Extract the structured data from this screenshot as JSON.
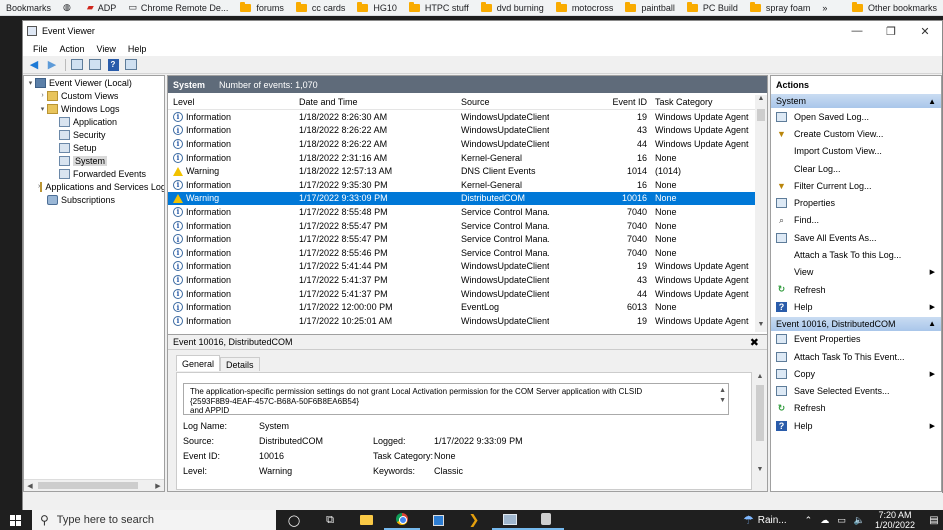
{
  "bookmarks": [
    {
      "label": "Bookmarks",
      "icon": "none"
    },
    {
      "label": "",
      "icon": "globe-icon"
    },
    {
      "label": "ADP",
      "icon": "adp-icon"
    },
    {
      "label": "Chrome Remote De...",
      "icon": "remote-icon"
    },
    {
      "label": "forums",
      "icon": "folder-icon"
    },
    {
      "label": "cc cards",
      "icon": "folder-icon"
    },
    {
      "label": "HG10",
      "icon": "folder-icon"
    },
    {
      "label": "HTPC stuff",
      "icon": "folder-icon"
    },
    {
      "label": "dvd burning",
      "icon": "folder-icon"
    },
    {
      "label": "motocross",
      "icon": "folder-icon"
    },
    {
      "label": "paintball",
      "icon": "folder-icon"
    },
    {
      "label": "PC Build",
      "icon": "folder-icon"
    },
    {
      "label": "spray foam",
      "icon": "folder-icon"
    },
    {
      "label": "»",
      "icon": "none"
    },
    {
      "label": "Other bookmarks",
      "icon": "folder-icon"
    }
  ],
  "window": {
    "title": "Event Viewer",
    "controls": {
      "minimize": "—",
      "restore": "❐",
      "close": "✕"
    }
  },
  "menu": [
    "File",
    "Action",
    "View",
    "Help"
  ],
  "tree": [
    {
      "label": "Event Viewer (Local)",
      "level": 0,
      "expander": "▾",
      "icon": "event-viewer-icon"
    },
    {
      "label": "Custom Views",
      "level": 1,
      "expander": "›",
      "icon": "folder-icon"
    },
    {
      "label": "Windows Logs",
      "level": 1,
      "expander": "▾",
      "icon": "folder-icon"
    },
    {
      "label": "Application",
      "level": 2,
      "expander": "",
      "icon": "log-icon"
    },
    {
      "label": "Security",
      "level": 2,
      "expander": "",
      "icon": "log-icon"
    },
    {
      "label": "Setup",
      "level": 2,
      "expander": "",
      "icon": "log-icon"
    },
    {
      "label": "System",
      "level": 2,
      "expander": "",
      "icon": "log-icon",
      "selected": true
    },
    {
      "label": "Forwarded Events",
      "level": 2,
      "expander": "",
      "icon": "log-icon"
    },
    {
      "label": "Applications and Services Log",
      "level": 1,
      "expander": "›",
      "icon": "folder-icon"
    },
    {
      "label": "Subscriptions",
      "level": 1,
      "expander": "",
      "icon": "subscriptions-icon"
    }
  ],
  "center": {
    "log_name": "System",
    "event_count": "Number of events: 1,070",
    "columns": {
      "level": "Level",
      "date": "Date and Time",
      "source": "Source",
      "id": "Event ID",
      "category": "Task Category"
    },
    "rows": [
      {
        "level": "Information",
        "date": "1/18/2022 8:26:30 AM",
        "source": "WindowsUpdateClient",
        "id": "19",
        "category": "Windows Update Agent"
      },
      {
        "level": "Information",
        "date": "1/18/2022 8:26:22 AM",
        "source": "WindowsUpdateClient",
        "id": "43",
        "category": "Windows Update Agent"
      },
      {
        "level": "Information",
        "date": "1/18/2022 8:26:22 AM",
        "source": "WindowsUpdateClient",
        "id": "44",
        "category": "Windows Update Agent"
      },
      {
        "level": "Information",
        "date": "1/18/2022 2:31:16 AM",
        "source": "Kernel-General",
        "id": "16",
        "category": "None"
      },
      {
        "level": "Warning",
        "date": "1/18/2022 12:57:13 AM",
        "source": "DNS Client Events",
        "id": "1014",
        "category": "(1014)"
      },
      {
        "level": "Information",
        "date": "1/17/2022 9:35:30 PM",
        "source": "Kernel-General",
        "id": "16",
        "category": "None"
      },
      {
        "level": "Warning",
        "date": "1/17/2022 9:33:09 PM",
        "source": "DistributedCOM",
        "id": "10016",
        "category": "None",
        "selected": true
      },
      {
        "level": "Information",
        "date": "1/17/2022 8:55:48 PM",
        "source": "Service Control Mana...",
        "id": "7040",
        "category": "None"
      },
      {
        "level": "Information",
        "date": "1/17/2022 8:55:47 PM",
        "source": "Service Control Mana...",
        "id": "7040",
        "category": "None"
      },
      {
        "level": "Information",
        "date": "1/17/2022 8:55:47 PM",
        "source": "Service Control Mana...",
        "id": "7040",
        "category": "None"
      },
      {
        "level": "Information",
        "date": "1/17/2022 8:55:46 PM",
        "source": "Service Control Mana...",
        "id": "7040",
        "category": "None"
      },
      {
        "level": "Information",
        "date": "1/17/2022 5:41:44 PM",
        "source": "WindowsUpdateClient",
        "id": "19",
        "category": "Windows Update Agent"
      },
      {
        "level": "Information",
        "date": "1/17/2022 5:41:37 PM",
        "source": "WindowsUpdateClient",
        "id": "43",
        "category": "Windows Update Agent"
      },
      {
        "level": "Information",
        "date": "1/17/2022 5:41:37 PM",
        "source": "WindowsUpdateClient",
        "id": "44",
        "category": "Windows Update Agent"
      },
      {
        "level": "Information",
        "date": "1/17/2022 12:00:00 PM",
        "source": "EventLog",
        "id": "6013",
        "category": "None"
      },
      {
        "level": "Information",
        "date": "1/17/2022 10:25:01 AM",
        "source": "WindowsUpdateClient",
        "id": "19",
        "category": "Windows Update Agent"
      }
    ]
  },
  "detail": {
    "header": "Event 10016, DistributedCOM",
    "close": "✖",
    "tabs": [
      "General",
      "Details"
    ],
    "description_lines": [
      "The application-specific permission settings do not grant Local Activation permission for the COM Server application with CLSID",
      "{2593F8B9-4EAF-457C-B68A-50F6B8EA6B54}",
      " and APPID"
    ],
    "fields": {
      "log_name_label": "Log Name:",
      "log_name": "System",
      "source_label": "Source:",
      "source": "DistributedCOM",
      "logged_label": "Logged:",
      "logged": "1/17/2022 9:33:09 PM",
      "event_id_label": "Event ID:",
      "event_id": "10016",
      "task_category_label": "Task Category:",
      "task_category": "None",
      "level_label": "Level:",
      "level": "Warning",
      "keywords_label": "Keywords:",
      "keywords": "Classic"
    }
  },
  "actions": {
    "title": "Actions",
    "sections": [
      {
        "title": "System",
        "items": [
          {
            "label": "Open Saved Log...",
            "icon": "open-log-icon",
            "submenu": false
          },
          {
            "label": "Create Custom View...",
            "icon": "filter-icon",
            "submenu": false
          },
          {
            "label": "Import Custom View...",
            "icon": "none",
            "submenu": false
          },
          {
            "label": "Clear Log...",
            "icon": "none",
            "submenu": false
          },
          {
            "label": "Filter Current Log...",
            "icon": "filter-icon",
            "submenu": false
          },
          {
            "label": "Properties",
            "icon": "properties-icon",
            "submenu": false
          },
          {
            "label": "Find...",
            "icon": "find-icon",
            "submenu": false
          },
          {
            "label": "Save All Events As...",
            "icon": "save-icon",
            "submenu": false
          },
          {
            "label": "Attach a Task To this Log...",
            "icon": "none",
            "submenu": false
          },
          {
            "label": "View",
            "icon": "none",
            "submenu": true
          },
          {
            "label": "Refresh",
            "icon": "refresh-icon",
            "submenu": false
          },
          {
            "label": "Help",
            "icon": "help-icon",
            "submenu": true
          }
        ]
      },
      {
        "title": "Event 10016, DistributedCOM",
        "items": [
          {
            "label": "Event Properties",
            "icon": "properties-icon",
            "submenu": false
          },
          {
            "label": "Attach Task To This Event...",
            "icon": "task-icon",
            "submenu": false
          },
          {
            "label": "Copy",
            "icon": "copy-icon",
            "submenu": true
          },
          {
            "label": "Save Selected Events...",
            "icon": "save-icon",
            "submenu": false
          },
          {
            "label": "Refresh",
            "icon": "refresh-icon",
            "submenu": false
          },
          {
            "label": "Help",
            "icon": "help-icon",
            "submenu": true
          }
        ]
      }
    ]
  },
  "taskbar": {
    "search_placeholder": "Type here to search",
    "weather": "Rain...",
    "time": "7:20 AM",
    "date": "1/20/2022"
  }
}
